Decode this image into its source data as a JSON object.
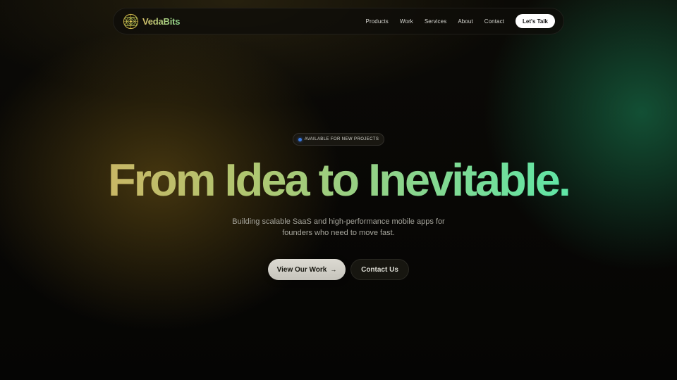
{
  "brand": {
    "name": "VedaBits",
    "logo_icon": "orbit-globe-icon"
  },
  "nav": {
    "links": [
      "Products",
      "Work",
      "Services",
      "About",
      "Contact"
    ],
    "cta_label": "Let's Talk"
  },
  "hero": {
    "badge": "AVAILABLE FOR NEW PROJECTS",
    "headline": "From Idea to Inevitable.",
    "subtitle_lines": [
      "Building scalable SaaS and high-performance mobile apps for",
      "founders who need to move fast."
    ],
    "primary_button": "View Our Work",
    "primary_button_icon": "arrow-right-icon",
    "secondary_button": "Contact Us"
  },
  "colors": {
    "gradient_start": "#c9b766",
    "gradient_end": "#5fe6a6",
    "badge_dot": "#3c7ae0",
    "cta_background": "#ffffff"
  }
}
